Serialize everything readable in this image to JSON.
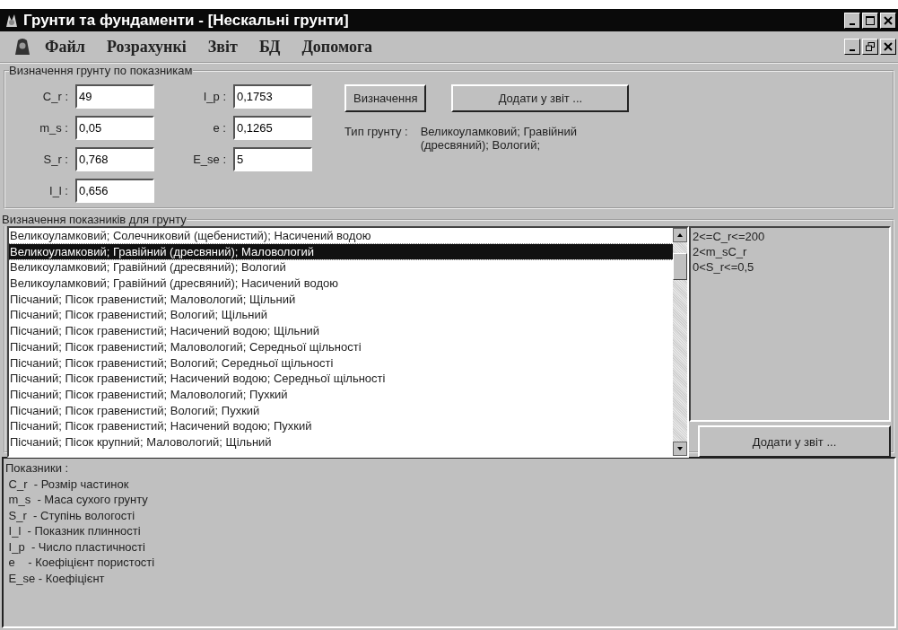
{
  "window": {
    "title": "Грунти та фундаменти - [Нескальні грунти]"
  },
  "menu": [
    {
      "label": "Файл"
    },
    {
      "label": "Розрахункі"
    },
    {
      "label": "Звіт"
    },
    {
      "label": "БД"
    },
    {
      "label": "Допомога"
    }
  ],
  "determination": {
    "title": "Визначення грунту по показникам",
    "field_columns": [
      [
        {
          "label": "C_r :",
          "value": "49"
        },
        {
          "label": "m_s :",
          "value": "0,05"
        },
        {
          "label": "S_r :",
          "value": "0,768"
        },
        {
          "label": "I_l :",
          "value": "0,656"
        }
      ],
      [
        {
          "label": "I_p :",
          "value": "0,1753"
        },
        {
          "label": "e :",
          "value": "0,1265"
        },
        {
          "label": "E_se :",
          "value": "5"
        }
      ]
    ],
    "buttons": [
      "Визначення",
      "Додати у звіт ..."
    ],
    "soil_type_label": "Тип грунту :",
    "soil_type_value": "Великоуламковий; Гравійний (дресвяний); Вологий;"
  },
  "indicators": {
    "title": "Визначення показників для грунту",
    "items": [
      {
        "text": "Великоуламковий; Солечниковий (щебенистий); Насичений водою",
        "selected": false
      },
      {
        "text": "Великоуламковий; Гравійний (дресвяний); Маловологий",
        "selected": true
      },
      {
        "text": "Великоуламковий; Гравійний (дресвяний); Вологий",
        "selected": false
      },
      {
        "text": "Великоуламковий; Гравійний (дресвяний); Насичений водою",
        "selected": false
      },
      {
        "text": "Пісчаний; Пісок гравенистий; Маловологий; Щільний",
        "selected": false
      },
      {
        "text": "Пісчаний; Пісок гравенистий; Вологий; Щільний",
        "selected": false
      },
      {
        "text": "Пісчаний; Пісок гравенистий; Насичений водою; Щільний",
        "selected": false
      },
      {
        "text": "Пісчаний; Пісок гравенистий; Маловологий; Середньої щільності",
        "selected": false
      },
      {
        "text": "Пісчаний; Пісок гравенистий; Вологий; Середньої щільності",
        "selected": false
      },
      {
        "text": "Пісчаний; Пісок гравенистий; Насичений водою; Середньої щільності",
        "selected": false
      },
      {
        "text": "Пісчаний; Пісок гравенистий; Маловологий; Пухкий",
        "selected": false
      },
      {
        "text": "Пісчаний; Пісок гравенистий; Вологий; Пухкий",
        "selected": false
      },
      {
        "text": "Пісчаний; Пісок гравенистий; Насичений водою; Пухкий",
        "selected": false
      },
      {
        "text": "Пісчаний; Пісок крупний; Маловологий; Щільний",
        "selected": false
      }
    ],
    "conditions": [
      "2<=C_r<=200",
      "2<m_sC_r",
      "0<S_r<=0,5"
    ],
    "button": "Додати у звіт ..."
  },
  "legend": {
    "heading": "Показники :",
    "lines": [
      " C_r  - Розмір частинок",
      " m_s  - Маса сухого грунту",
      " S_r  - Ступінь вологості",
      " I_l  - Показник плинності",
      " I_p  - Число пластичності",
      " e    - Коефіцієнт пористості",
      " E_se - Коефіцієнт"
    ]
  }
}
